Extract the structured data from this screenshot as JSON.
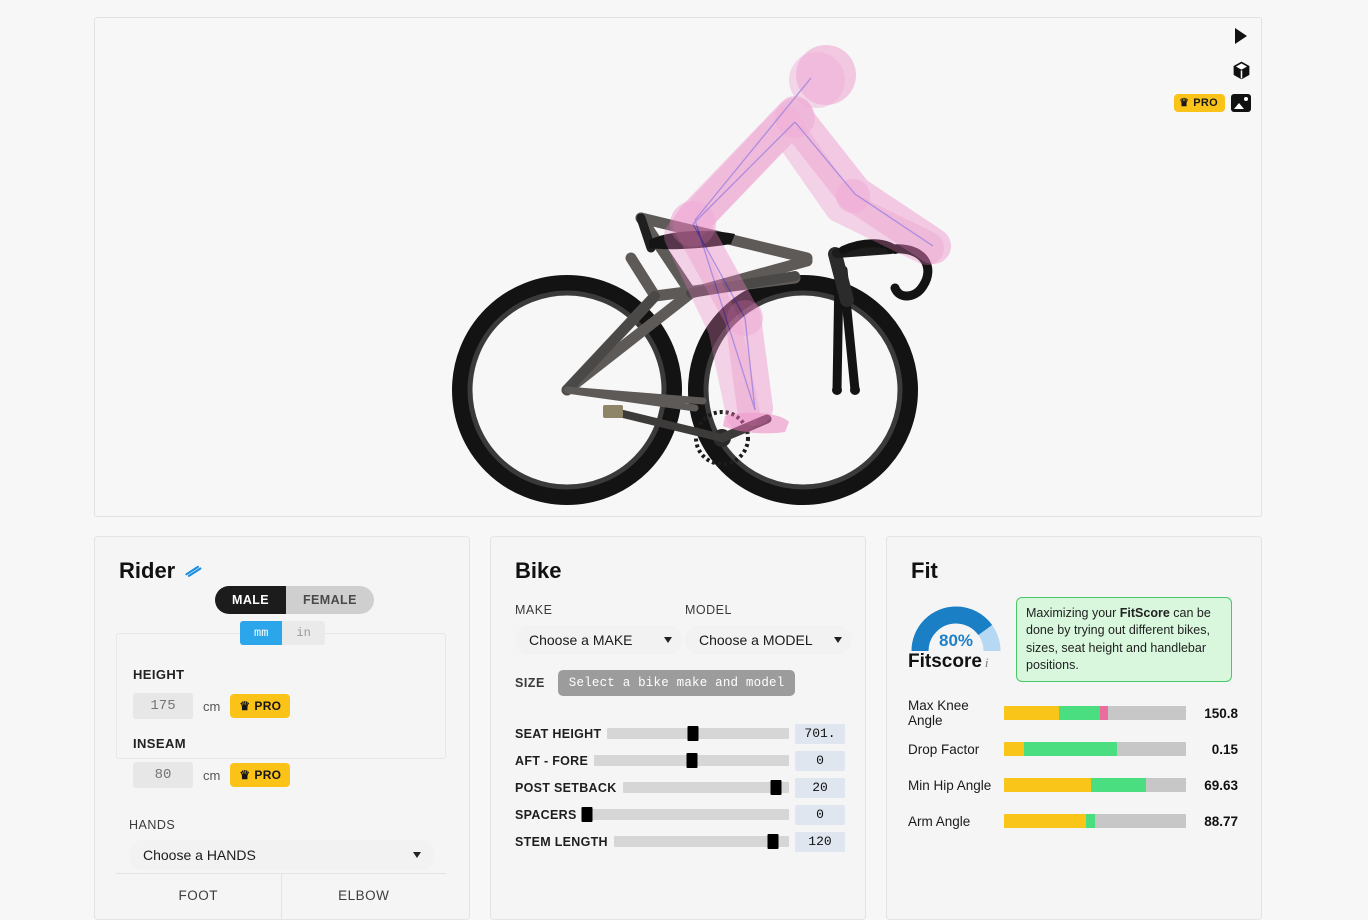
{
  "viewport": {
    "tools": {
      "play_icon": "play-triangle-icon",
      "cube_icon": "3d-cube-icon",
      "pro_label": "PRO",
      "crown": "♛",
      "image_icon": "image-export-icon"
    },
    "scene": {
      "rider_color": "#f08fcb",
      "skeleton_color": "#7b4bd8",
      "frame_color": "#5c5c5c",
      "tire_color": "#121212",
      "background": "#f7f7f7"
    }
  },
  "rider": {
    "title": "Rider",
    "hide_icon": "eye-slash-icon",
    "gender": {
      "male": "MALE",
      "female": "FEMALE",
      "selected": "MALE"
    },
    "units": {
      "mm": "mm",
      "in": "in",
      "selected": "mm"
    },
    "height": {
      "label": "HEIGHT",
      "value": "175",
      "unit": "cm",
      "pro": "PRO"
    },
    "inseam": {
      "label": "INSEAM",
      "value": "80",
      "unit": "cm",
      "pro": "PRO"
    },
    "hands": {
      "label": "HANDS",
      "placeholder": "Choose a HANDS"
    },
    "tabs": [
      {
        "label": "FOOT"
      },
      {
        "label": "ELBOW"
      }
    ]
  },
  "bike": {
    "title": "Bike",
    "make": {
      "label": "MAKE",
      "placeholder": "Choose a MAKE"
    },
    "model": {
      "label": "MODEL",
      "placeholder": "Choose a MODEL"
    },
    "size": {
      "label": "SIZE",
      "button": "Select a bike make and model"
    },
    "sliders": [
      {
        "name": "SEAT HEIGHT",
        "value": "701.",
        "pos": 47
      },
      {
        "name": "AFT - FORE",
        "value": "0",
        "pos": 50
      },
      {
        "name": "POST SETBACK",
        "value": "20",
        "pos": 92
      },
      {
        "name": "SPACERS",
        "value": "0",
        "pos": 2
      },
      {
        "name": "STEM LENGTH",
        "value": "120",
        "pos": 91
      }
    ]
  },
  "fit": {
    "title": "Fit",
    "fitscore": {
      "percent": "80%",
      "value": 80,
      "label": "Fitscore",
      "info_icon": "info-icon",
      "arc_color": "#1a7fc4",
      "arc_track_color": "#b6d8f2"
    },
    "tip": {
      "text_before": "Maximizing your ",
      "bold": "FitScore",
      "text_after": " can be done by trying out different bikes, sizes, seat height and handlebar positions."
    },
    "metrics": [
      {
        "name": "Max Knee Angle",
        "value": "150.8",
        "yellow": 30,
        "green": 53,
        "marker": 57,
        "marker_color": "#ec6c9e"
      },
      {
        "name": "Drop Factor",
        "value": "0.15",
        "yellow": 11,
        "green": 62,
        "marker": null,
        "marker_color": "#ec6c9e"
      },
      {
        "name": "Min Hip Angle",
        "value": "69.63",
        "yellow": 48,
        "green": 78,
        "marker": null,
        "marker_color": "#ec6c9e"
      },
      {
        "name": "Arm Angle",
        "value": "88.77",
        "yellow": 45,
        "green": 50,
        "marker": null,
        "marker_color": "#ec6c9e"
      }
    ],
    "colors": {
      "yellow": "#f9c518",
      "green": "#4ade80",
      "gray": "#c7c7c7"
    }
  }
}
